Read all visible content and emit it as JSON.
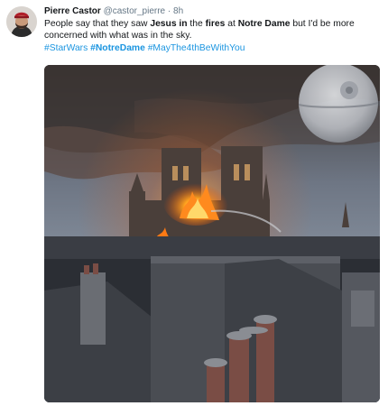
{
  "tweet": {
    "display_name": "Pierre Castor",
    "handle": "@castor_pierre",
    "separator": "·",
    "time": "8h",
    "text_parts": [
      "People say that they saw ",
      "Jesus in",
      " the ",
      "fires",
      " at ",
      "Notre Dame",
      " but I'd be more concerned with what was in the sky."
    ],
    "hashtags": [
      "#StarWars",
      "#NotreDame",
      "#MayThe4thBeWithYou"
    ],
    "avatar": "avatar-bearded-man-red-cap",
    "media": {
      "description_icon": "photo-notre-dame-fire-death-star",
      "colors": {
        "fire": "#ff8a1e",
        "smoke": "#6b5a52",
        "sky": "#8a96a6",
        "accent_link": "#1b95e0"
      }
    }
  }
}
